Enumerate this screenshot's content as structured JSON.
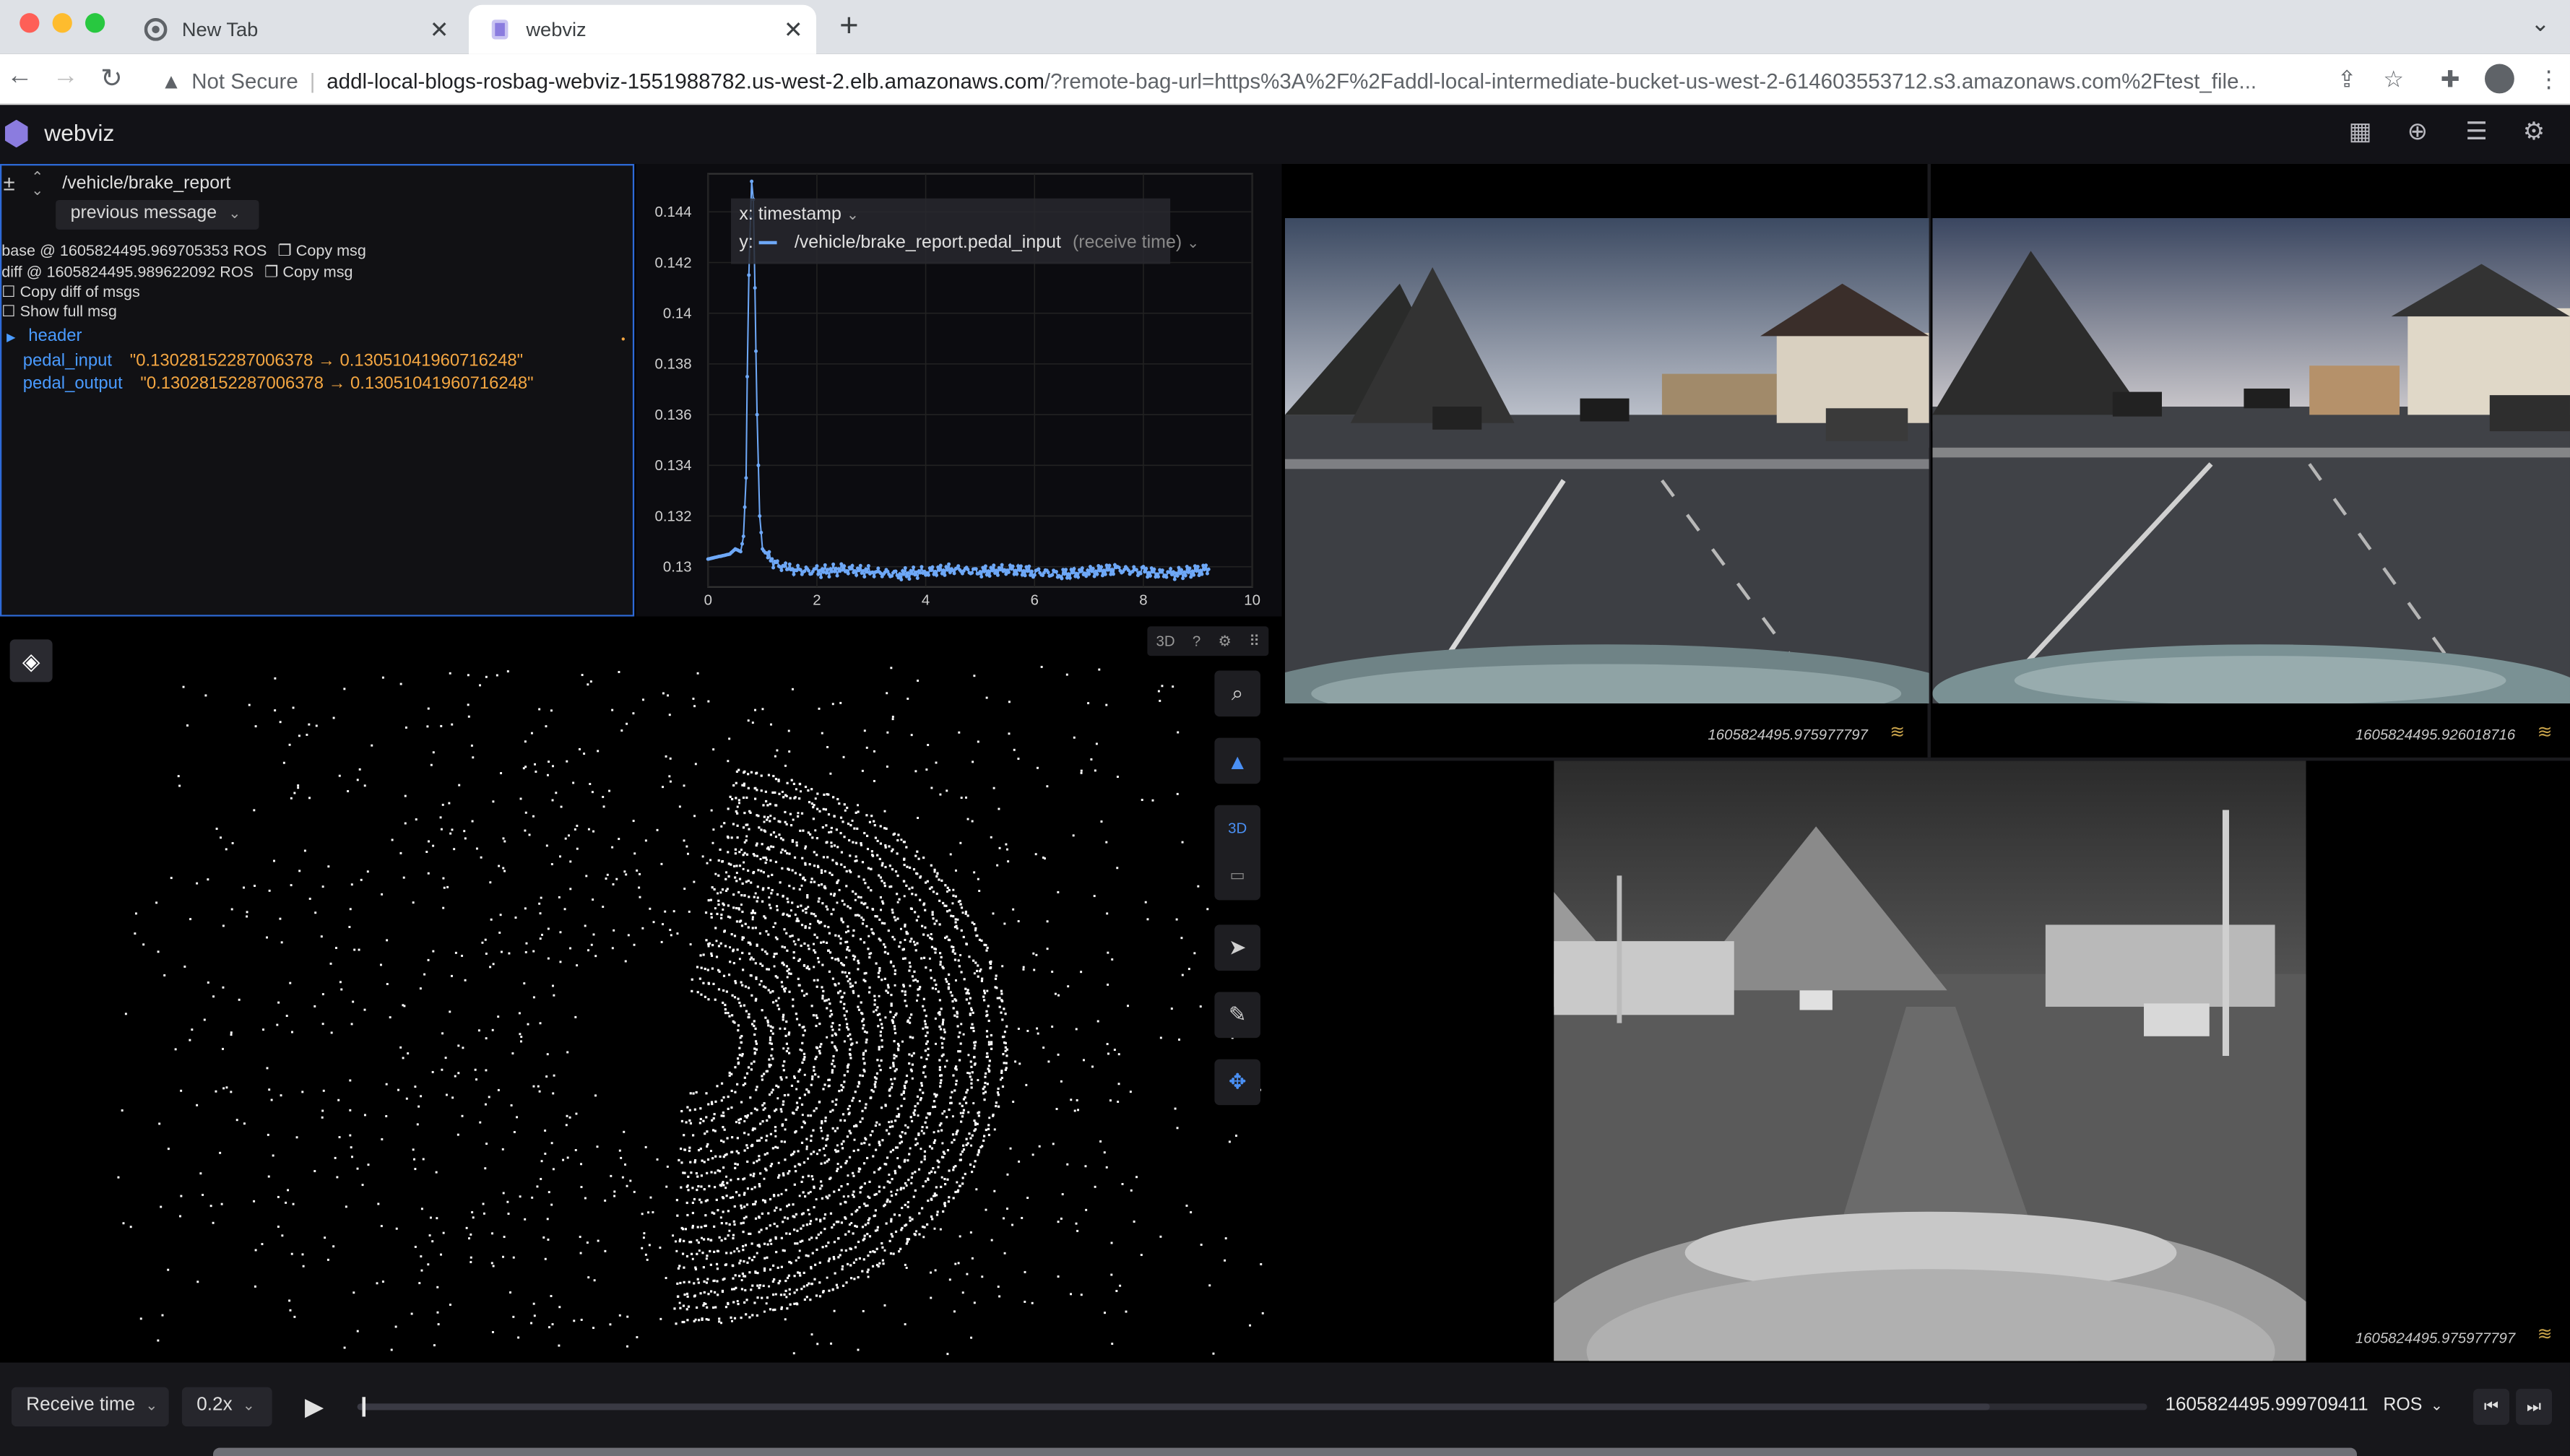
{
  "browser": {
    "tabs": [
      {
        "title": "New Tab"
      },
      {
        "title": "webviz"
      }
    ],
    "url": {
      "security": "Not Secure",
      "host": "addl-local-blogs-rosbag-webviz-1551988782.us-west-2.elb.amazonaws.com",
      "rest": "/?remote-bag-url=https%3A%2F%2Faddl-local-intermediate-bucket-us-west-2-614603553712.s3.amazonaws.com%2Ftest_file..."
    }
  },
  "app": {
    "name": "webviz"
  },
  "raw_messages": {
    "topic": "/vehicle/brake_report",
    "mode": "previous message",
    "base_line": "base @ 1605824495.969705353 ROS",
    "diff_line": "diff @ 1605824495.989622092 ROS",
    "copy_msg": "Copy msg",
    "copy_diff": "Copy diff of msgs",
    "show_full": "Show full msg",
    "header_key": "header",
    "fields": [
      {
        "key": "pedal_input",
        "value": "\"0.13028152287006378 → 0.13051041960716248\""
      },
      {
        "key": "pedal_output",
        "value": "\"0.13028152287006378 → 0.13051041960716248\""
      }
    ]
  },
  "plot": {
    "x_label": "x:",
    "x_value": "timestamp",
    "y_label": "y:",
    "y_path": "/vehicle/brake_report.pedal_input",
    "y_suffix": "(receive time)",
    "series_color": "#6ea8f7"
  },
  "chart_data": {
    "type": "line",
    "x_ticks": [
      "0",
      "2",
      "4",
      "6",
      "8",
      "10"
    ],
    "y_ticks": [
      "0.13",
      "0.132",
      "0.134",
      "0.136",
      "0.138",
      "0.14",
      "0.142",
      "0.144"
    ],
    "xlim": [
      0,
      10
    ],
    "ylim": [
      0.1292,
      0.1455
    ],
    "series": [
      {
        "x": [
          0,
          0.2,
          0.4,
          0.5,
          0.6,
          0.65,
          0.7,
          0.72,
          0.75,
          0.78,
          0.8,
          0.83,
          0.86,
          0.9,
          0.95,
          1.0,
          1.1,
          1.25,
          1.5,
          2,
          2.5,
          3,
          3.5,
          4,
          4.5,
          5,
          5.5,
          6,
          6.5,
          7,
          7.5,
          8,
          8.5,
          9.2
        ],
        "y": [
          0.1303,
          0.1304,
          0.1305,
          0.1307,
          0.1306,
          0.1312,
          0.1335,
          0.1375,
          0.1415,
          0.1438,
          0.1452,
          0.1445,
          0.141,
          0.136,
          0.132,
          0.1307,
          0.1304,
          0.1301,
          0.1299,
          0.1298,
          0.1299,
          0.1298,
          0.1297,
          0.1298,
          0.1299,
          0.1298,
          0.1299,
          0.1298,
          0.1297,
          0.1298,
          0.1299,
          0.1298,
          0.1297,
          0.1299
        ]
      }
    ]
  },
  "viz3d": {
    "mode": "3D",
    "tools": [
      "search-icon",
      "follow-arrow-icon",
      "3d-toggle",
      "ruler-icon",
      "select-cursor-icon",
      "draw-pencil-icon",
      "move-crosshair-icon"
    ],
    "tool_3d_label": "3D"
  },
  "cameras": [
    {
      "stamp": "1605824495.975977797"
    },
    {
      "stamp": "1605824495.926018716"
    },
    {
      "stamp": "1605824495.975977797"
    }
  ],
  "playback": {
    "time_mode": "Receive time",
    "speed": "0.2x",
    "current_time": "1605824495.999709411",
    "time_format": "ROS",
    "progress": 0.003,
    "loaded": 0.912
  }
}
